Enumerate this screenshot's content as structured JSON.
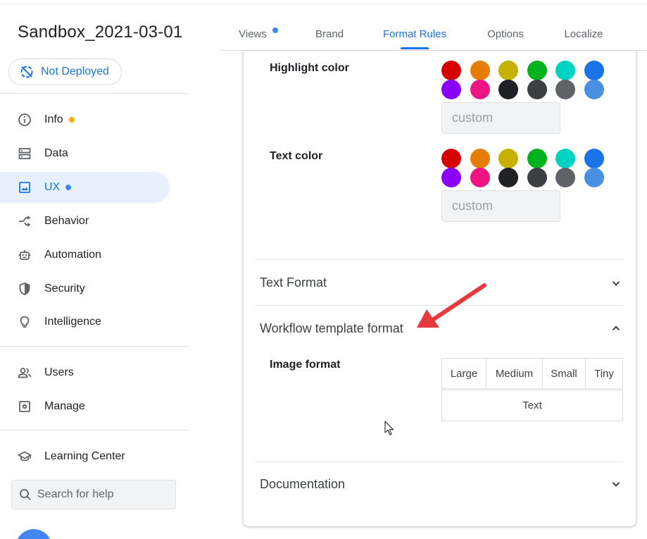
{
  "app": {
    "title": "Sandbox_2021-03-01",
    "deploy_status": "Not Deployed"
  },
  "sidebar": {
    "items": [
      {
        "label": "Info",
        "icon": "info-icon",
        "dot": "#f9ab00"
      },
      {
        "label": "Data",
        "icon": "data-icon"
      },
      {
        "label": "UX",
        "icon": "image-icon",
        "dot": "#4285f4",
        "active": true
      },
      {
        "label": "Behavior",
        "icon": "behavior-icon"
      },
      {
        "label": "Automation",
        "icon": "robot-icon"
      },
      {
        "label": "Security",
        "icon": "shield-icon"
      },
      {
        "label": "Intelligence",
        "icon": "lightbulb-icon"
      },
      {
        "label": "Users",
        "icon": "users-icon"
      },
      {
        "label": "Manage",
        "icon": "gear-icon"
      },
      {
        "label": "Learning Center",
        "icon": "school-icon"
      }
    ],
    "search": {
      "placeholder": "Search for help"
    }
  },
  "tabs": [
    {
      "label": "Views",
      "dot": "#4285f4"
    },
    {
      "label": "Brand"
    },
    {
      "label": "Format Rules",
      "active": true
    },
    {
      "label": "Options"
    },
    {
      "label": "Localize"
    }
  ],
  "format": {
    "highlight_label": "Highlight color",
    "text_color_label": "Text color",
    "custom_placeholder": "custom",
    "palette": [
      "#d50000",
      "#e67c00",
      "#c6b000",
      "#00b31e",
      "#00d3c2",
      "#1a73e8",
      "#8a00ff",
      "#f01483",
      "#202124",
      "#3c4043",
      "#5f6368",
      "#4a90e2"
    ]
  },
  "sections": {
    "text_format": "Text Format",
    "workflow_template_format": "Workflow template format",
    "documentation": "Documentation"
  },
  "image_format": {
    "label": "Image format",
    "options": [
      "Large",
      "Medium",
      "Small",
      "Tiny"
    ],
    "text_option": "Text"
  },
  "colors": {
    "accent": "#1a73e8",
    "annotation_arrow": "#e8393f"
  }
}
